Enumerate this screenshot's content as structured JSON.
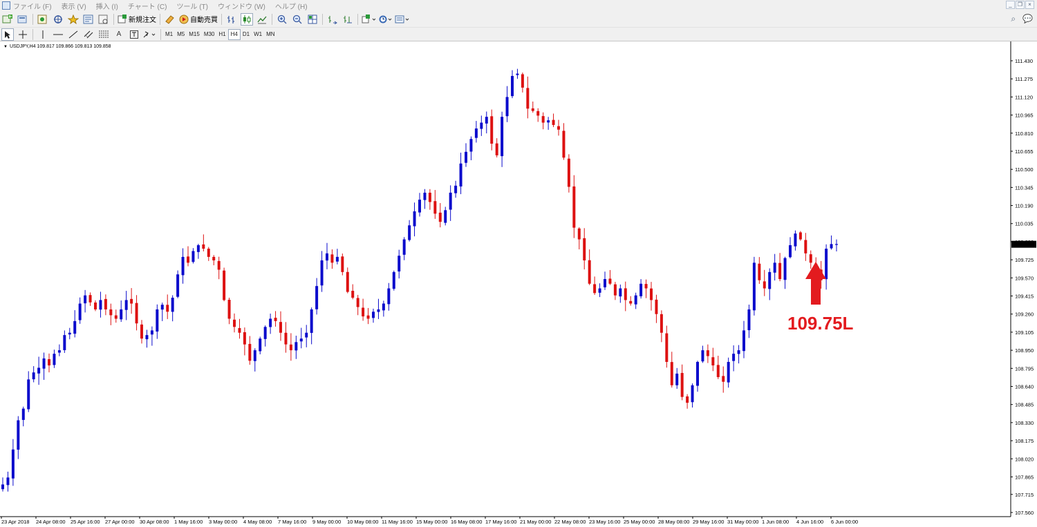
{
  "menu": {
    "items": [
      "ファイル (F)",
      "表示 (V)",
      "挿入 (I)",
      "チャート (C)",
      "ツール (T)",
      "ウィンドウ (W)",
      "ヘルプ (H)"
    ]
  },
  "toolbar": {
    "new_order_label": "新規注文",
    "auto_trade_label": "自動売買",
    "timeframes": [
      "M1",
      "M5",
      "M15",
      "M30",
      "H1",
      "H4",
      "D1",
      "W1",
      "MN"
    ],
    "active_timeframe": "H4"
  },
  "chart": {
    "header": "USDJPY,H4  109.817 109.866 109.813 109.858",
    "current_price_label": "109.858",
    "annotation": "109.75L",
    "colors": {
      "bull": "#0a0acc",
      "bear": "#dd1111",
      "annotation": "#e31b1f",
      "background": "#ffffff"
    }
  },
  "chart_data": {
    "type": "candlestick",
    "symbol": "USDJPY",
    "timeframe": "H4",
    "ylim": [
      107.56,
      111.5
    ],
    "price_ticks": [
      "111.430",
      "111.275",
      "111.120",
      "110.965",
      "110.810",
      "110.655",
      "110.500",
      "110.345",
      "110.190",
      "110.035",
      "109.880",
      "109.725",
      "109.570",
      "109.415",
      "109.260",
      "109.105",
      "108.950",
      "108.795",
      "108.640",
      "108.485",
      "108.330",
      "108.175",
      "108.020",
      "107.865",
      "107.715",
      "107.560"
    ],
    "time_ticks": [
      "23 Apr 2018",
      "24 Apr 08:00",
      "25 Apr 16:00",
      "27 Apr 00:00",
      "30 Apr 08:00",
      "1 May 16:00",
      "3 May 00:00",
      "4 May 08:00",
      "7 May 16:00",
      "9 May 00:00",
      "10 May 08:00",
      "11 May 16:00",
      "15 May 00:00",
      "16 May 08:00",
      "17 May 16:00",
      "21 May 00:00",
      "22 May 08:00",
      "23 May 16:00",
      "25 May 00:00",
      "28 May 08:00",
      "29 May 16:00",
      "31 May 00:00",
      "1 Jun 08:00",
      "4 Jun 16:00",
      "6 Jun 00:00"
    ],
    "close_path": [
      107.8,
      107.86,
      108.1,
      108.35,
      108.45,
      108.7,
      108.76,
      108.8,
      108.88,
      108.82,
      108.92,
      108.95,
      109.08,
      109.1,
      109.2,
      109.35,
      109.42,
      109.36,
      109.3,
      109.38,
      109.3,
      109.25,
      109.22,
      109.3,
      109.38,
      109.35,
      109.18,
      109.05,
      109.08,
      109.12,
      109.3,
      109.34,
      109.28,
      109.4,
      109.6,
      109.75,
      109.7,
      109.8,
      109.85,
      109.82,
      109.75,
      109.72,
      109.64,
      109.38,
      109.22,
      109.15,
      109.1,
      109.0,
      108.86,
      108.95,
      109.05,
      109.15,
      109.22,
      109.2,
      109.1,
      109.0,
      108.95,
      109.02,
      109.05,
      109.1,
      109.3,
      109.5,
      109.72,
      109.78,
      109.7,
      109.75,
      109.62,
      109.45,
      109.4,
      109.32,
      109.24,
      109.22,
      109.28,
      109.3,
      109.35,
      109.48,
      109.62,
      109.76,
      109.9,
      110.02,
      110.14,
      110.24,
      110.3,
      110.22,
      110.12,
      110.05,
      110.15,
      110.3,
      110.36,
      110.55,
      110.65,
      110.76,
      110.85,
      110.9,
      110.95,
      110.72,
      110.62,
      110.95,
      111.12,
      111.3,
      111.32,
      111.2,
      111.02,
      111.0,
      110.96,
      110.9,
      110.92,
      110.88,
      110.84,
      110.6,
      110.35,
      110.0,
      109.9,
      109.72,
      109.52,
      109.44,
      109.48,
      109.56,
      109.52,
      109.42,
      109.48,
      109.38,
      109.35,
      109.42,
      109.52,
      109.48,
      109.38,
      109.26,
      109.1,
      108.85,
      108.65,
      108.75,
      108.55,
      108.5,
      108.65,
      108.85,
      108.95,
      108.9,
      108.82,
      108.72,
      108.68,
      108.85,
      108.92,
      108.95,
      109.12,
      109.3,
      109.7,
      109.55,
      109.48,
      109.62,
      109.7,
      109.56,
      109.74,
      109.85,
      109.95,
      109.9,
      109.78,
      109.7,
      109.64,
      109.55,
      109.82,
      109.86,
      109.86
    ]
  }
}
